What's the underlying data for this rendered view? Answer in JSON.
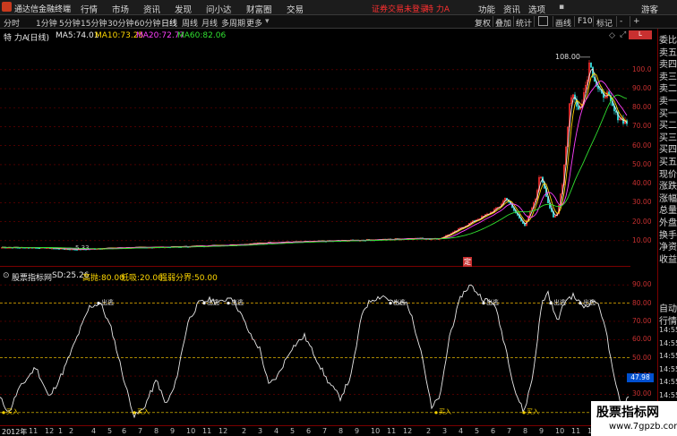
{
  "topbar": {
    "app_title": "通达信金融终端",
    "menus": [
      "行情",
      "市场",
      "资讯",
      "发现",
      "问小达",
      "财富圈",
      "交易"
    ],
    "status_text": "证券交易未登录",
    "stock_title": "特 力A",
    "right_menus": [
      "功能",
      "资讯",
      "选项",
      "游客"
    ]
  },
  "timeframe_bar": {
    "items": [
      "分时",
      "1分钟",
      "5分钟",
      "15分钟",
      "30分钟",
      "60分钟",
      "日线",
      "周线",
      "月线",
      "多周期",
      "更多"
    ],
    "active": "日线",
    "tools": [
      "复权",
      "叠加",
      "统计",
      "画线",
      "F10",
      "标记",
      "-",
      "+"
    ]
  },
  "main_chart": {
    "stock_name": "特 力A",
    "period": "(日线)",
    "ma": [
      {
        "label": "MA5:",
        "value": "74.01",
        "color": "#e8e8e8"
      },
      {
        "label": "MA10:",
        "value": "73.25",
        "color": "#ffd700"
      },
      {
        "label": "MA20:",
        "value": "72.77",
        "color": "#ff40ff"
      },
      {
        "label": "MA60:",
        "value": "82.06",
        "color": "#30e030"
      }
    ],
    "high_label": "108.00",
    "low_label": "5.33",
    "marker_label": "定",
    "y_ticks": [
      "100.0",
      "90.00",
      "80.00",
      "70.00",
      "60.00",
      "50.00",
      "40.00",
      "30.00",
      "20.00",
      "10.00"
    ],
    "y_tick_values": [
      100,
      90,
      80,
      70,
      60,
      50,
      40,
      30,
      20,
      10
    ],
    "y_range": [
      0,
      115
    ]
  },
  "indicator": {
    "name": "股票指标网",
    "params": [
      {
        "label": "SD:",
        "value": "25.26",
        "color": "#e8e8e8"
      },
      {
        "label": "高抛:",
        "value": "80.00",
        "color": "#ffd700"
      },
      {
        "label": "低吸:",
        "value": "20.00",
        "color": "#ffd700"
      },
      {
        "label": "强弱分界:",
        "value": "50.00",
        "color": "#ffd700"
      }
    ],
    "sell_label": "出逃",
    "buy_label": "买入",
    "current_value": "47.98",
    "y_ticks": [
      "90.00",
      "80.00",
      "70.00",
      "60.00",
      "50.00",
      "40.00",
      "30.00"
    ],
    "y_tick_values": [
      90,
      80,
      70,
      60,
      50,
      40,
      30
    ],
    "y_range": [
      15,
      95
    ]
  },
  "xaxis": {
    "labels": [
      "2012年",
      "11",
      "12",
      "1",
      "2",
      "4",
      "5",
      "6",
      "7",
      "8",
      "9",
      "10",
      "11",
      "12",
      "2",
      "3",
      "4",
      "5",
      "6",
      "7",
      "8",
      "9",
      "10",
      "11",
      "12",
      "2",
      "3",
      "4",
      "5",
      "6",
      "7",
      "8",
      "9",
      "10",
      "11",
      "12"
    ]
  },
  "right_panel": {
    "items": [
      "委比",
      "卖五",
      "卖四",
      "卖三",
      "卖二",
      "卖一",
      "买一",
      "买二",
      "买三",
      "买四",
      "买五",
      "现价",
      "涨跌",
      "涨幅",
      "总量",
      "外盘",
      "换手",
      "净资",
      "收益",
      "自动",
      "行情",
      "14:55",
      "14:55",
      "14:55",
      "14:55",
      "14:55",
      "14:55",
      "14:55",
      "14:55"
    ]
  },
  "watermark": {
    "title": "股票指标网",
    "url": "www.7gpzb.com"
  },
  "colors": {
    "background": "#000000",
    "grid_red": "#7a0000",
    "price_up": "#ff3030",
    "price_down": "#30d0d0",
    "ma5": "#e8e8e8",
    "ma10": "#ffd700",
    "ma20": "#ff40ff",
    "ma60": "#30e030",
    "indicator_line": "#e8e8e8",
    "level_line": "#ffd700"
  }
}
